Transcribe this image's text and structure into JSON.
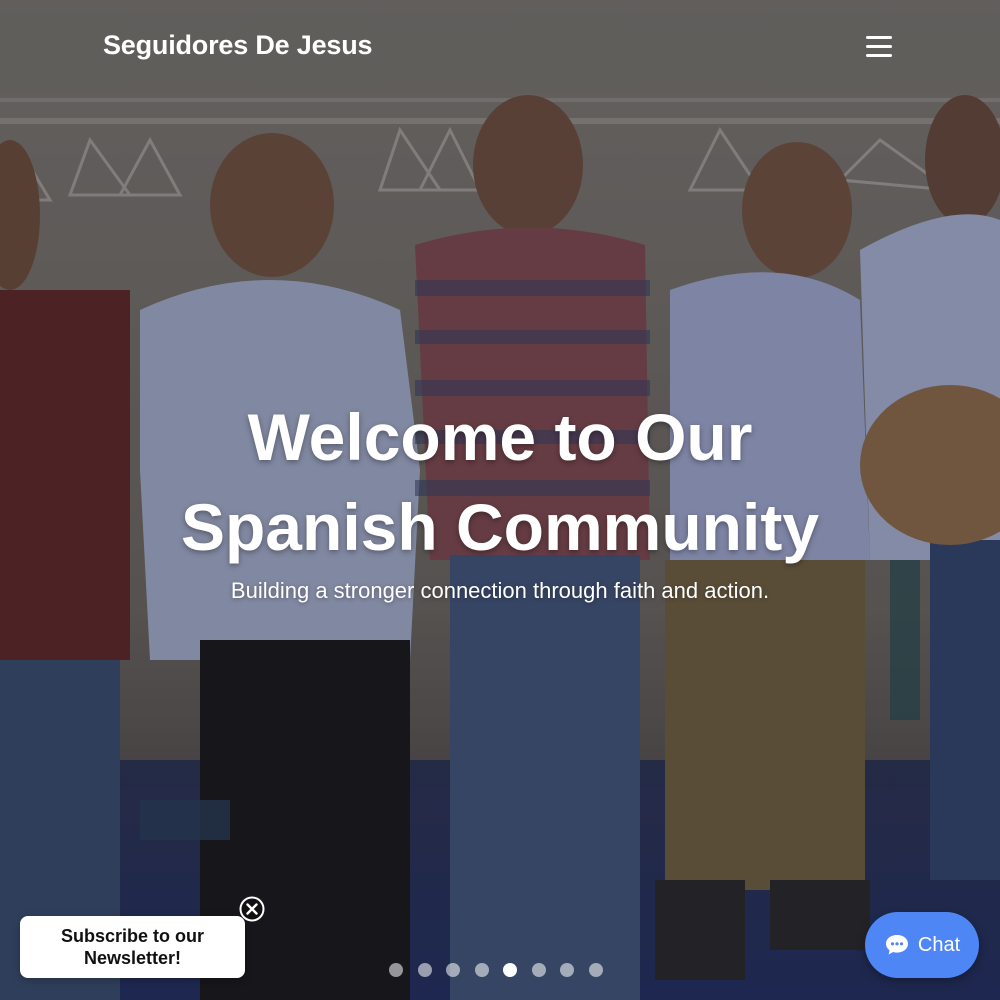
{
  "header": {
    "site_title": "Seguidores De Jesus",
    "menu_icon": "hamburger-menu-icon"
  },
  "hero": {
    "title_line1": "Welcome to Our",
    "title_line2": "Spanish Community",
    "subtitle": "Building a stronger connection through faith and action.",
    "image_subject": "group-photo-background"
  },
  "carousel": {
    "slide_count": 8,
    "active_index": 4
  },
  "newsletter": {
    "line1": "Subscribe to our",
    "line2": "Newsletter!",
    "close_icon": "close-circle-icon"
  },
  "chat": {
    "label": "Chat",
    "icon": "chat-bubble-icon",
    "color": "#4e86f5"
  },
  "colors": {
    "header_overlay": "#5f5c5a",
    "text": "#ffffff",
    "dot_inactive": "#cfcfcf",
    "dot_active": "#ffffff"
  }
}
